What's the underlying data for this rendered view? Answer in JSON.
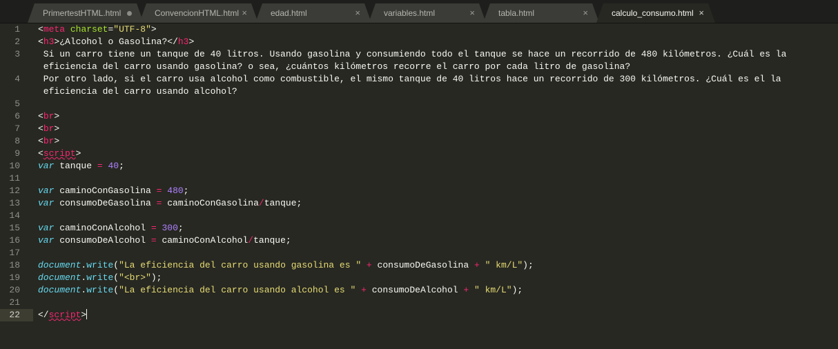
{
  "tabs": [
    {
      "label": "PrimertestHTML.html",
      "dirty": true,
      "active": false
    },
    {
      "label": "ConvencionHTML.html",
      "dirty": false,
      "active": false
    },
    {
      "label": "edad.html",
      "dirty": false,
      "active": false
    },
    {
      "label": "variables.html",
      "dirty": false,
      "active": false
    },
    {
      "label": "tabla.html",
      "dirty": false,
      "active": false
    },
    {
      "label": "calculo_consumo.html",
      "dirty": false,
      "active": true
    }
  ],
  "close_glyph": "×",
  "gutter": [
    "1",
    "2",
    "3",
    "",
    "4",
    "",
    "5",
    "6",
    "7",
    "8",
    "9",
    "10",
    "11",
    "12",
    "13",
    "14",
    "15",
    "16",
    "17",
    "18",
    "19",
    "20",
    "21",
    "22"
  ],
  "current_line": "22",
  "code": {
    "l1": {
      "open": "<",
      "tag": "meta",
      "sp": " ",
      "attr": "charset",
      "eq": "=",
      "val": "\"UTF-8\"",
      "close": ">"
    },
    "l2": {
      "open": "<",
      "tag": "h3",
      "gt": ">",
      "text": "¿Alcohol o Gasolina?",
      "lt": "</",
      "tag2": "h3",
      "close": ">"
    },
    "l3a": " Si un carro tiene un tanque de 40 litros. Usando gasolina y consumiendo todo el tanque se hace un recorrido de 480 kilómetros. ¿Cuál es la",
    "l3b": " eficiencia del carro usando gasolina? o sea, ¿cuántos kilómetros recorre el carro por cada litro de gasolina?",
    "l4a": " Por otro lado, si el carro usa alcohol como combustible, el mismo tanque de 40 litros hace un recorrido de 300 kilómetros. ¿Cuál es el la",
    "l4b": " eficiencia del carro usando alcohol?",
    "br": {
      "open": "<",
      "tag": "br",
      "close": ">"
    },
    "script_open": {
      "open": "<",
      "tag": "script",
      "close": ">"
    },
    "l10": {
      "kw": "var",
      "name": " tanque ",
      "op": "=",
      "sp": " ",
      "num": "40",
      "end": ";"
    },
    "l12": {
      "kw": "var",
      "name": " caminoConGasolina ",
      "op": "=",
      "sp": " ",
      "num": "480",
      "end": ";"
    },
    "l13": {
      "kw": "var",
      "name": " consumoDeGasolina ",
      "op": "=",
      "rest1": " caminoConGasolina",
      "div": "/",
      "rest2": "tanque;"
    },
    "l15": {
      "kw": "var",
      "name": " caminoConAlcohol ",
      "op": "=",
      "sp": " ",
      "num": "300",
      "end": ";"
    },
    "l16": {
      "kw": "var",
      "name": " consumoDeAlcohol ",
      "op": "=",
      "rest1": " caminoConAlcohol",
      "div": "/",
      "rest2": "tanque;"
    },
    "l18": {
      "obj": "document",
      "dot": ".",
      "fn": "write",
      "paren": "(",
      "s1": "\"La eficiencia del carro usando gasolina es \"",
      "p1": " + ",
      "v": "consumoDeGasolina",
      "p2": " + ",
      "s2": "\" km/L\"",
      "end": ");"
    },
    "l19": {
      "obj": "document",
      "dot": ".",
      "fn": "write",
      "paren": "(",
      "s1": "\"<br>\"",
      "end": ");"
    },
    "l20": {
      "obj": "document",
      "dot": ".",
      "fn": "write",
      "paren": "(",
      "s1": "\"La eficiencia del carro usando alcohol es \"",
      "p1": " + ",
      "v": "consumoDeAlcohol",
      "p2": " + ",
      "s2": "\" km/L\"",
      "end": ");"
    },
    "script_close": {
      "open": "</",
      "tag": "script",
      "close": ">"
    }
  },
  "colors": {
    "background": "#272822",
    "tag": "#f92672",
    "attribute": "#a6e22e",
    "string": "#e6db74",
    "keyword": "#66d9ef",
    "number": "#ae81ff"
  }
}
